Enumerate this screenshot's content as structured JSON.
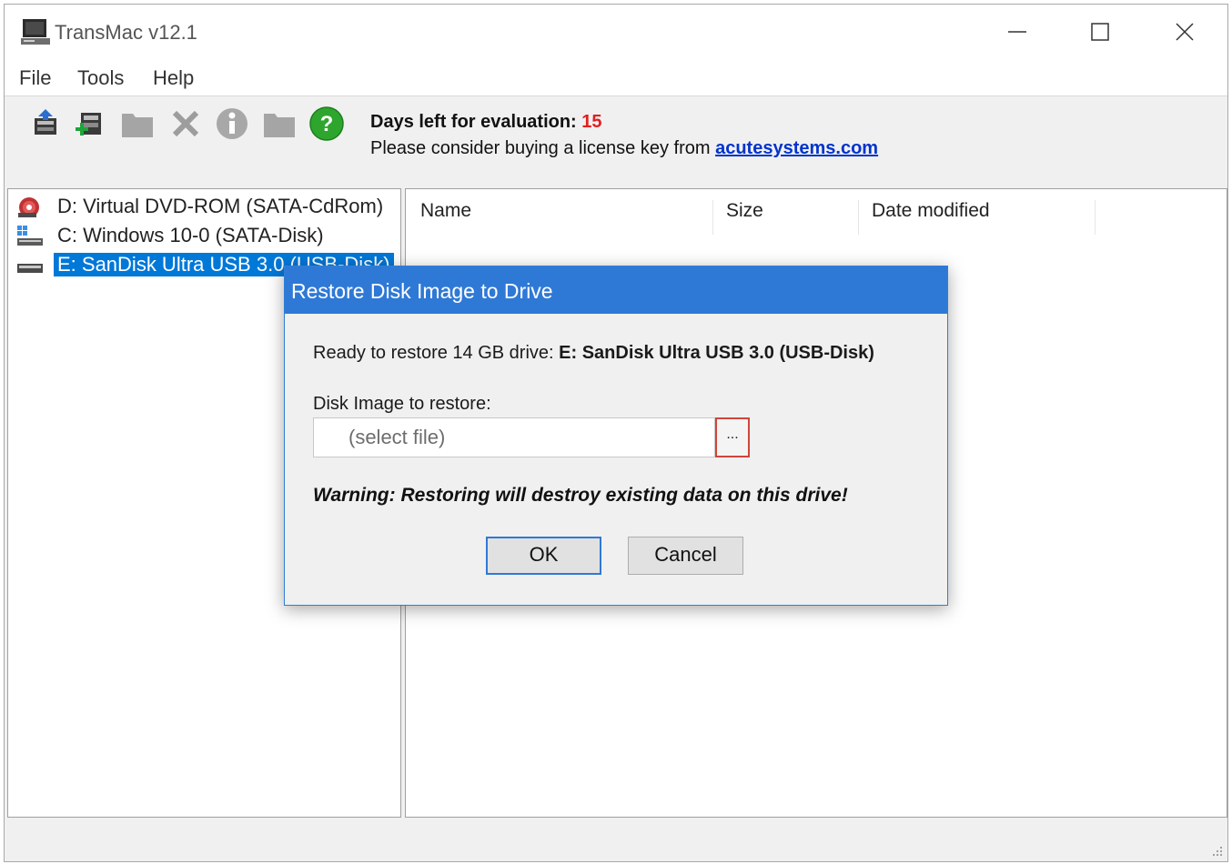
{
  "window": {
    "title": "TransMac v12.1"
  },
  "menu": {
    "items": [
      "File",
      "Tools",
      "Help"
    ]
  },
  "toolbar": {
    "icons": [
      "restore-disk-image-icon",
      "add-disk-image-icon",
      "folder-icon",
      "delete-icon",
      "info-icon",
      "new-folder-icon",
      "help-icon"
    ],
    "eval_label": "Days left for evaluation: ",
    "eval_days": "15",
    "license_text": "Please consider buying a license key from ",
    "license_link": "acutesystems.com"
  },
  "drives": [
    {
      "label": "D:  Virtual DVD-ROM (SATA-CdRom)",
      "icon": "dvd-drive-icon",
      "selected": false
    },
    {
      "label": "C:  Windows 10-0 (SATA-Disk)",
      "icon": "windows-disk-icon",
      "selected": false
    },
    {
      "label": "E: SanDisk Ultra USB 3.0 (USB-Disk)",
      "icon": "usb-drive-icon",
      "selected": true
    }
  ],
  "file_list": {
    "columns": [
      "Name",
      "Size",
      "Date modified"
    ]
  },
  "dialog": {
    "title": "Restore Disk Image to Drive",
    "ready_prefix": "Ready to restore 14 GB drive: ",
    "ready_drive": "E: SanDisk Ultra USB 3.0 (USB-Disk)",
    "image_label": "Disk Image to restore:",
    "file_placeholder": "(select file)",
    "browse_label": "...",
    "warning": "Warning: Restoring will destroy existing data on this drive!",
    "ok_label": "OK",
    "cancel_label": "Cancel"
  },
  "colors": {
    "accent": "#2f79d6",
    "selection": "#0078d7",
    "eval_days": "#e02020",
    "link": "#0033cc",
    "browse_highlight": "#d0453a"
  }
}
